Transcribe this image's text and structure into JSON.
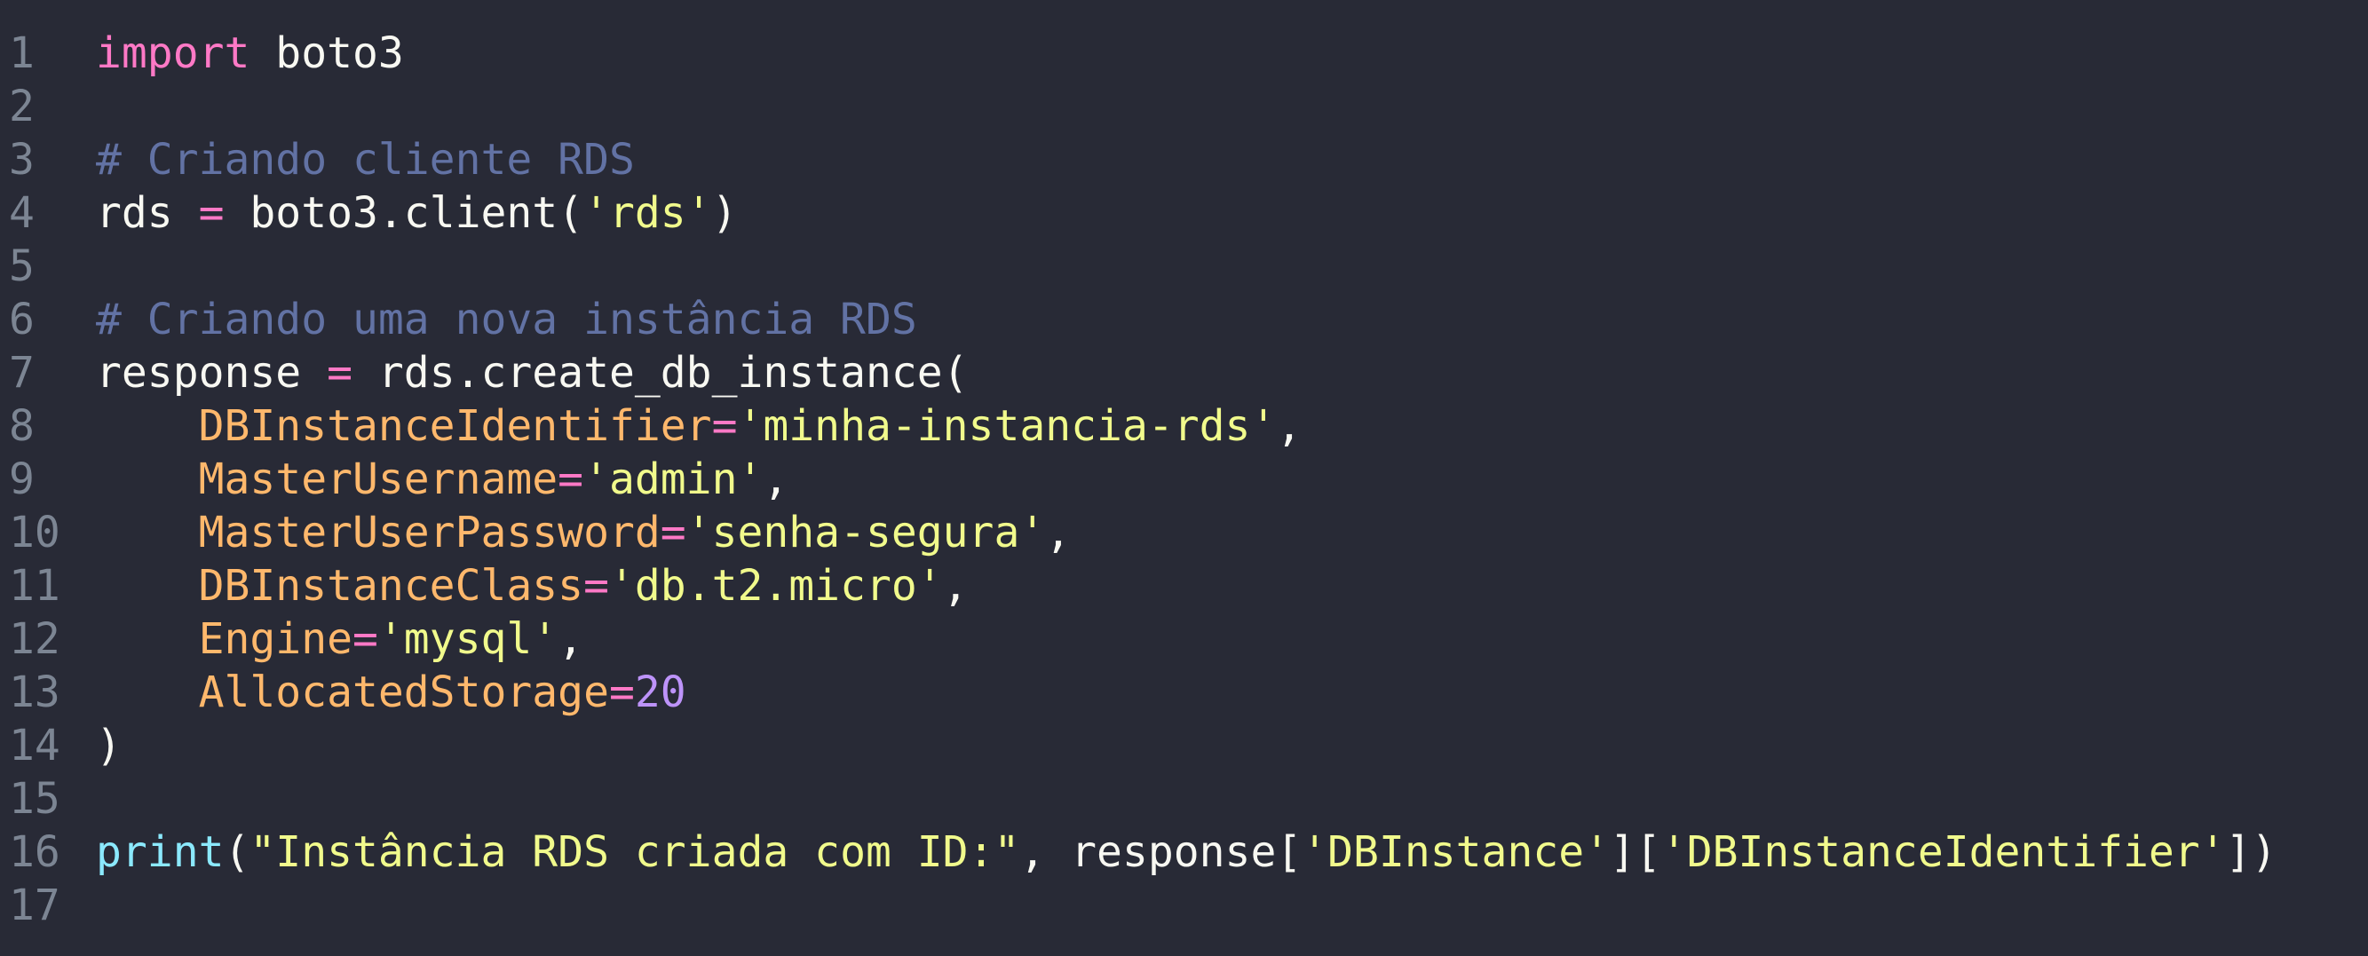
{
  "theme": {
    "background": "#282a36",
    "gutter": "#7c8593",
    "plain": "#f8f8f2",
    "keyword": "#ff79c6",
    "comment": "#6272a4",
    "string": "#f1fa8c",
    "parameter": "#ffb86c",
    "number": "#bd93f9",
    "builtin": "#8be9fd"
  },
  "lines": [
    {
      "n": "1",
      "tokens": [
        {
          "t": "import",
          "k": "keyword"
        },
        {
          "t": " boto3",
          "k": "plain"
        }
      ]
    },
    {
      "n": "2",
      "tokens": []
    },
    {
      "n": "3",
      "tokens": [
        {
          "t": "# Criando cliente RDS",
          "k": "comment"
        }
      ]
    },
    {
      "n": "4",
      "tokens": [
        {
          "t": "rds ",
          "k": "plain"
        },
        {
          "t": "=",
          "k": "operator"
        },
        {
          "t": " boto3.client(",
          "k": "plain"
        },
        {
          "t": "'rds'",
          "k": "string"
        },
        {
          "t": ")",
          "k": "plain"
        }
      ]
    },
    {
      "n": "5",
      "tokens": []
    },
    {
      "n": "6",
      "tokens": [
        {
          "t": "# Criando uma nova instância RDS",
          "k": "comment"
        }
      ]
    },
    {
      "n": "7",
      "tokens": [
        {
          "t": "response ",
          "k": "plain"
        },
        {
          "t": "=",
          "k": "operator"
        },
        {
          "t": " rds.create_db_instance(",
          "k": "plain"
        }
      ]
    },
    {
      "n": "8",
      "tokens": [
        {
          "t": "    ",
          "k": "plain"
        },
        {
          "t": "DBInstanceIdentifier",
          "k": "param"
        },
        {
          "t": "=",
          "k": "operator"
        },
        {
          "t": "'minha-instancia-rds'",
          "k": "string"
        },
        {
          "t": ",",
          "k": "plain"
        }
      ]
    },
    {
      "n": "9",
      "tokens": [
        {
          "t": "    ",
          "k": "plain"
        },
        {
          "t": "MasterUsername",
          "k": "param"
        },
        {
          "t": "=",
          "k": "operator"
        },
        {
          "t": "'admin'",
          "k": "string"
        },
        {
          "t": ",",
          "k": "plain"
        }
      ]
    },
    {
      "n": "10",
      "tokens": [
        {
          "t": "    ",
          "k": "plain"
        },
        {
          "t": "MasterUserPassword",
          "k": "param"
        },
        {
          "t": "=",
          "k": "operator"
        },
        {
          "t": "'senha-segura'",
          "k": "string"
        },
        {
          "t": ",",
          "k": "plain"
        }
      ]
    },
    {
      "n": "11",
      "tokens": [
        {
          "t": "    ",
          "k": "plain"
        },
        {
          "t": "DBInstanceClass",
          "k": "param"
        },
        {
          "t": "=",
          "k": "operator"
        },
        {
          "t": "'db.t2.micro'",
          "k": "string"
        },
        {
          "t": ",",
          "k": "plain"
        }
      ]
    },
    {
      "n": "12",
      "tokens": [
        {
          "t": "    ",
          "k": "plain"
        },
        {
          "t": "Engine",
          "k": "param"
        },
        {
          "t": "=",
          "k": "operator"
        },
        {
          "t": "'mysql'",
          "k": "string"
        },
        {
          "t": ",",
          "k": "plain"
        }
      ]
    },
    {
      "n": "13",
      "tokens": [
        {
          "t": "    ",
          "k": "plain"
        },
        {
          "t": "AllocatedStorage",
          "k": "param"
        },
        {
          "t": "=",
          "k": "operator"
        },
        {
          "t": "20",
          "k": "number"
        }
      ]
    },
    {
      "n": "14",
      "tokens": [
        {
          "t": ")",
          "k": "plain"
        }
      ]
    },
    {
      "n": "15",
      "tokens": []
    },
    {
      "n": "16",
      "tokens": [
        {
          "t": "print",
          "k": "builtin"
        },
        {
          "t": "(",
          "k": "plain"
        },
        {
          "t": "\"Instância RDS criada com ID:\"",
          "k": "string"
        },
        {
          "t": ", response[",
          "k": "plain"
        },
        {
          "t": "'DBInstance'",
          "k": "string"
        },
        {
          "t": "][",
          "k": "plain"
        },
        {
          "t": "'DBInstanceIdentifier'",
          "k": "string"
        },
        {
          "t": "])",
          "k": "plain"
        }
      ]
    },
    {
      "n": "17",
      "tokens": []
    }
  ]
}
